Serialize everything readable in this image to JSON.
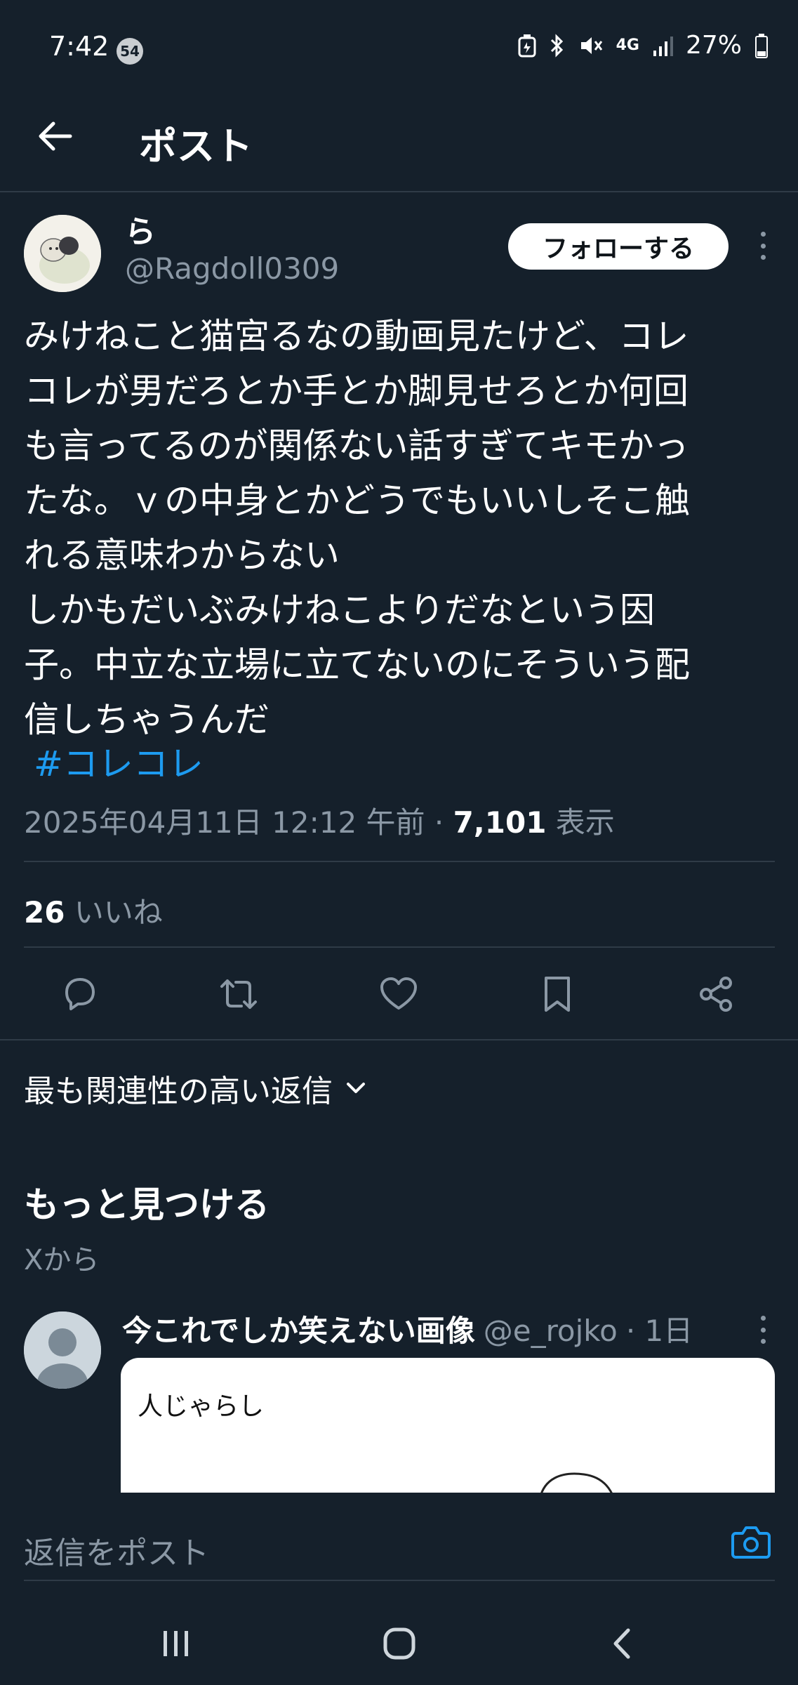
{
  "status_bar": {
    "time": "7:42",
    "notification_count": "54",
    "battery": "27%",
    "network": "4G"
  },
  "header": {
    "title": "ポスト",
    "icon": "arrow-left-icon"
  },
  "tweet": {
    "author": {
      "name": "ら",
      "handle": "@Ragdoll0309"
    },
    "follow_label": "フォローする",
    "text": "みけねこと猫宮るなの動画見たけど、コレ\nコレが男だろとか手とか脚見せろとか何回\nも言ってるのが関係ない話すぎてキモかっ\nたな。ｖの中身とかどうでもいいしそこ触\nれる意味わからない\nしかもだいぶみけねこよりだなという因\n子。中立な立場に立てないのにそういう配\n信しちゃうんだ",
    "hashtag": "#コレコレ",
    "timestamp": "2025年04月11日 12:12 午前 · ",
    "views_count": "7,101",
    "views_label": " 表示",
    "likes_count": "26",
    "likes_label": " いいね"
  },
  "actions": {
    "reply_icon": "reply-icon",
    "retweet_icon": "retweet-icon",
    "like_icon": "heart-icon",
    "bookmark_icon": "bookmark-icon",
    "share_icon": "share-icon"
  },
  "replies_sort": {
    "label": "最も関連性の高い返信"
  },
  "discover": {
    "title": "もっと見つける",
    "subtitle": "Xから",
    "item": {
      "name": "今これでしか笑えない画像",
      "handle": "@e_rojko",
      "time": "· 1日",
      "card_text": "人じゃらし"
    }
  },
  "reply_bar": {
    "placeholder": "返信をポスト"
  },
  "colors": {
    "background": "#15202b",
    "accent": "#1d9bf0",
    "muted_text": "#8b98a5",
    "divider": "#2f3b47"
  }
}
